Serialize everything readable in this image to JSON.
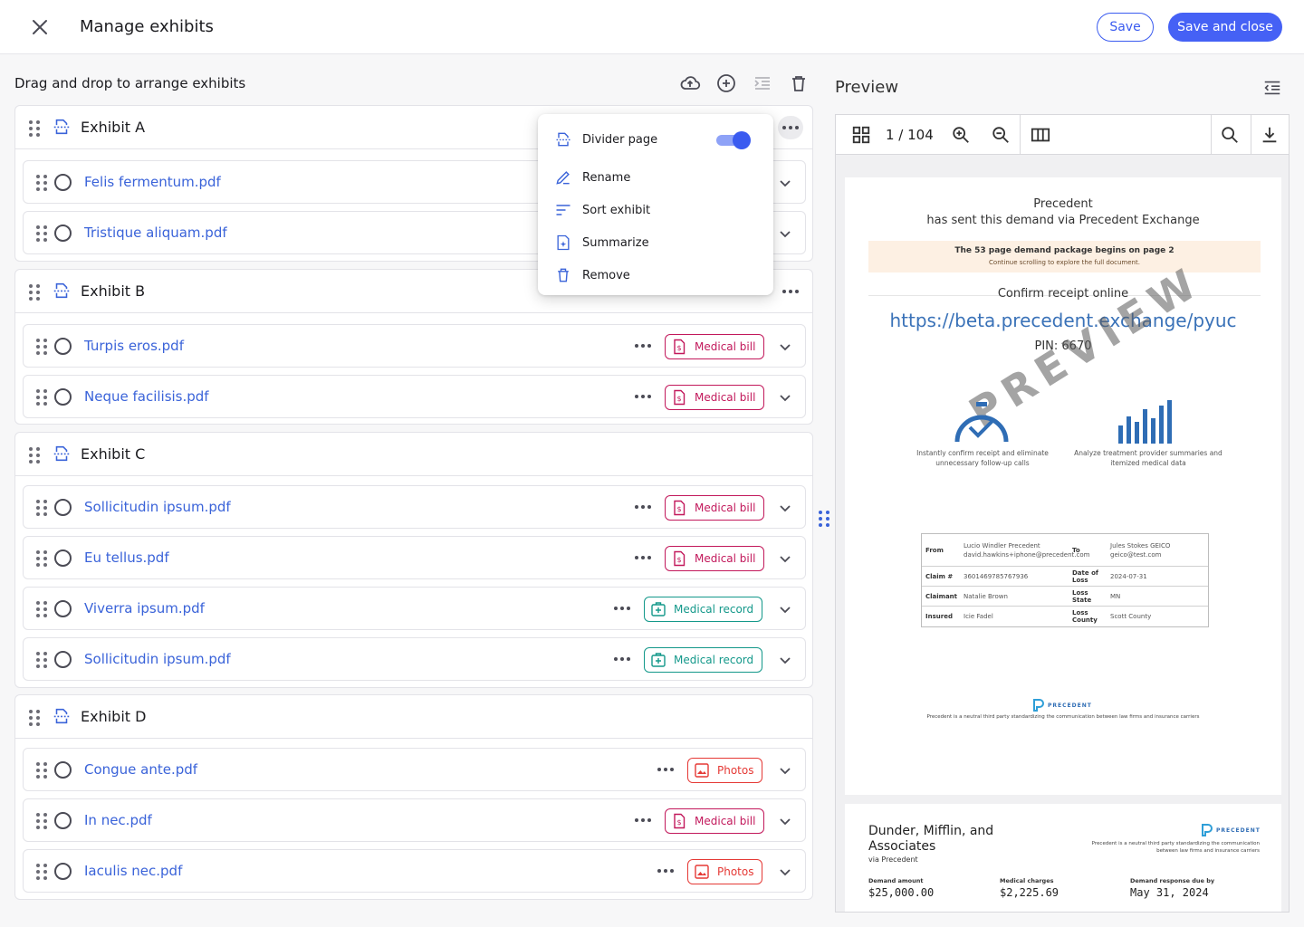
{
  "header": {
    "title": "Manage exhibits",
    "save_label": "Save",
    "save_close_label": "Save and close"
  },
  "left": {
    "subtitle": "Drag and drop to arrange exhibits"
  },
  "exhibits": [
    {
      "name": "Exhibit A",
      "files": [
        {
          "name": "Felis fermentum.pdf",
          "tag": ""
        },
        {
          "name": "Tristique aliquam.pdf",
          "tag": ""
        }
      ]
    },
    {
      "name": "Exhibit B",
      "files": [
        {
          "name": "Turpis eros.pdf",
          "tag": "Medical bill"
        },
        {
          "name": "Neque facilisis.pdf",
          "tag": "Medical bill"
        }
      ]
    },
    {
      "name": "Exhibit C",
      "files": [
        {
          "name": "Sollicitudin ipsum.pdf",
          "tag": "Medical bill"
        },
        {
          "name": "Eu tellus.pdf",
          "tag": "Medical bill"
        },
        {
          "name": "Viverra ipsum.pdf",
          "tag": "Medical record"
        },
        {
          "name": "Sollicitudin ipsum.pdf",
          "tag": "Medical record"
        }
      ]
    },
    {
      "name": "Exhibit D",
      "files": [
        {
          "name": "Congue ante.pdf",
          "tag": "Photos"
        },
        {
          "name": "In nec.pdf",
          "tag": "Medical bill"
        },
        {
          "name": "Iaculis nec.pdf",
          "tag": "Photos"
        }
      ]
    }
  ],
  "context_menu": {
    "divider_page": "Divider page",
    "divider_page_on": true,
    "rename": "Rename",
    "sort": "Sort exhibit",
    "summarize": "Summarize",
    "remove": "Remove"
  },
  "preview": {
    "title": "Preview",
    "page_counter": "1 / 104",
    "page1": {
      "org": "Precedent",
      "sent_line": "has sent this demand via Precedent Exchange",
      "banner_bold": "The 53 page demand package begins on page 2",
      "banner_sub": "Continue scrolling to explore the full document.",
      "confirm": "Confirm receipt online",
      "url": "https://beta.precedent.exchange/pyuc",
      "pin": "PIN: 6670",
      "watermark": "PREVIEW",
      "feature1": "Instantly confirm receipt and eliminate unnecessary follow-up calls",
      "feature2": "Analyze treatment provider summaries and itemized medical data",
      "table": {
        "from_label": "From",
        "from_value": "Lucio Windler Precedent david.hawkins+iphone@precedent.com",
        "to_label": "To",
        "to_value": "Jules Stokes GEICO geico@test.com",
        "claim_label": "Claim #",
        "claim_value": "3601469785767936",
        "dol_label": "Date of Loss",
        "dol_value": "2024-07-31",
        "claimant_label": "Claimant",
        "claimant_value": "Natalie Brown",
        "loss_state_label": "Loss State",
        "loss_state_value": "MN",
        "insured_label": "Insured",
        "insured_value": "Icie Fadel",
        "loss_county_label": "Loss County",
        "loss_county_value": "Scott County"
      },
      "footer_brand": "PRECEDENT",
      "footer_text": "Precedent is a neutral third party standardizing the communication between law firms and insurance carriers"
    },
    "page2": {
      "firm": "Dunder, Mifflin, and Associates",
      "via": "via Precedent",
      "brand": "PRECEDENT",
      "brand_text": "Precedent is a neutral third party standardizing the communication between law firms and insurance carriers",
      "demand_amount_label": "Demand amount",
      "demand_amount": "$25,000.00",
      "medical_charges_label": "Medical charges",
      "medical_charges": "$2,225.69",
      "due_label": "Demand response due by",
      "due": "May 31, 2024"
    }
  },
  "colors": {
    "accent": "#4561f5",
    "link": "#3a63d9",
    "medical_bill": "#c2185b",
    "medical_record": "#13988a",
    "photos": "#e53935"
  }
}
